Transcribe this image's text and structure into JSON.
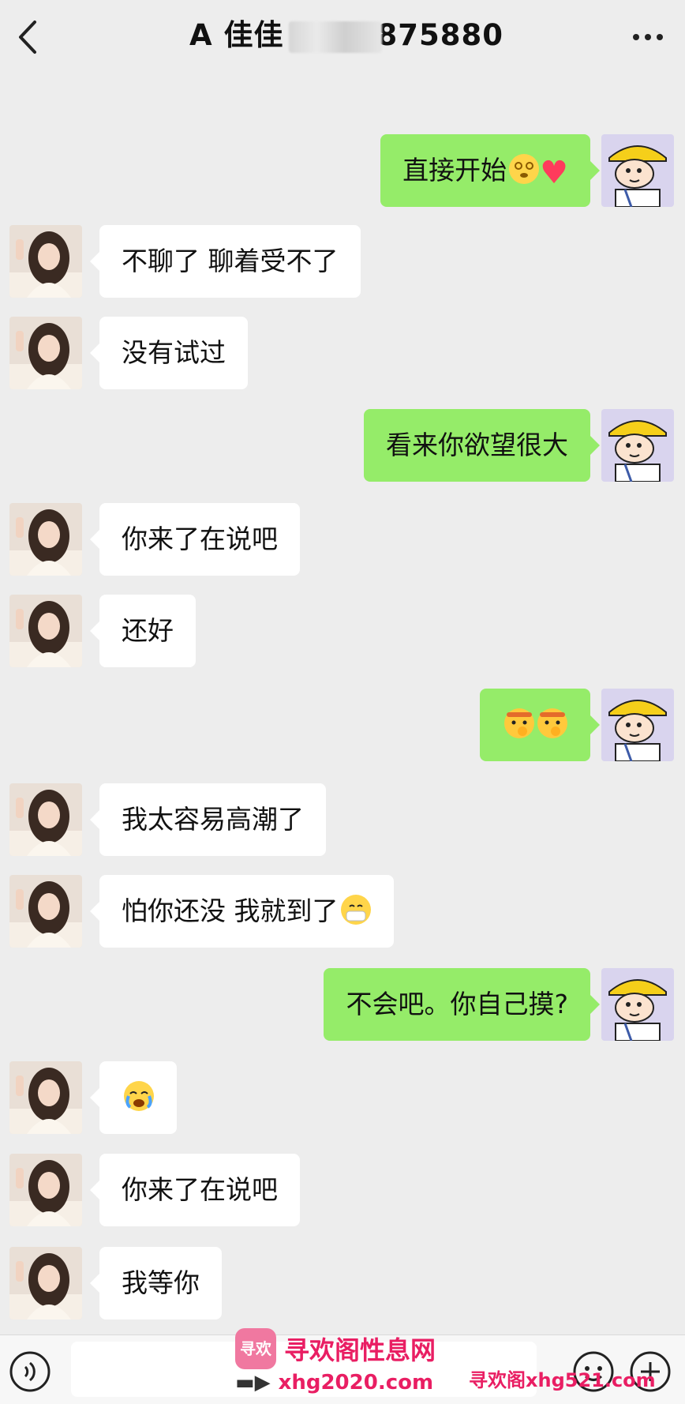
{
  "header": {
    "title_prefix": "A 佳佳",
    "title_suffix": "875880",
    "back_icon": "chevron-left-icon",
    "more_icon": "more-dots-icon"
  },
  "messages": [
    {
      "side": "out",
      "text": "直接开始",
      "emojis": [
        "dizzy-face",
        "heart"
      ]
    },
    {
      "side": "in",
      "text": "不聊了 聊着受不了"
    },
    {
      "side": "in",
      "text": "没有试过"
    },
    {
      "side": "out",
      "text": "看来你欲望很大"
    },
    {
      "side": "in",
      "text": "你来了在说吧"
    },
    {
      "side": "in",
      "text": "还好"
    },
    {
      "side": "out",
      "text": "",
      "emojis": [
        "pondering-face",
        "pondering-face"
      ]
    },
    {
      "side": "in",
      "text": "我太容易高潮了"
    },
    {
      "side": "in",
      "text": "怕你还没 我就到了",
      "emojis": [
        "mask-face"
      ]
    },
    {
      "side": "out",
      "text": "不会吧。你自己摸?"
    },
    {
      "side": "in",
      "text": "",
      "emojis": [
        "crying-face"
      ]
    },
    {
      "side": "in",
      "text": "你来了在说吧"
    },
    {
      "side": "in",
      "text": "我等你"
    }
  ],
  "watermark": {
    "logo": "寻欢",
    "site_name": "寻欢阁性息网",
    "url1": "xhg2020.com",
    "url2": "寻欢阁xhg521.com"
  },
  "colors": {
    "background": "#ededed",
    "outgoing_bubble": "#95ec69",
    "incoming_bubble": "#ffffff",
    "watermark": "#e91e63"
  }
}
